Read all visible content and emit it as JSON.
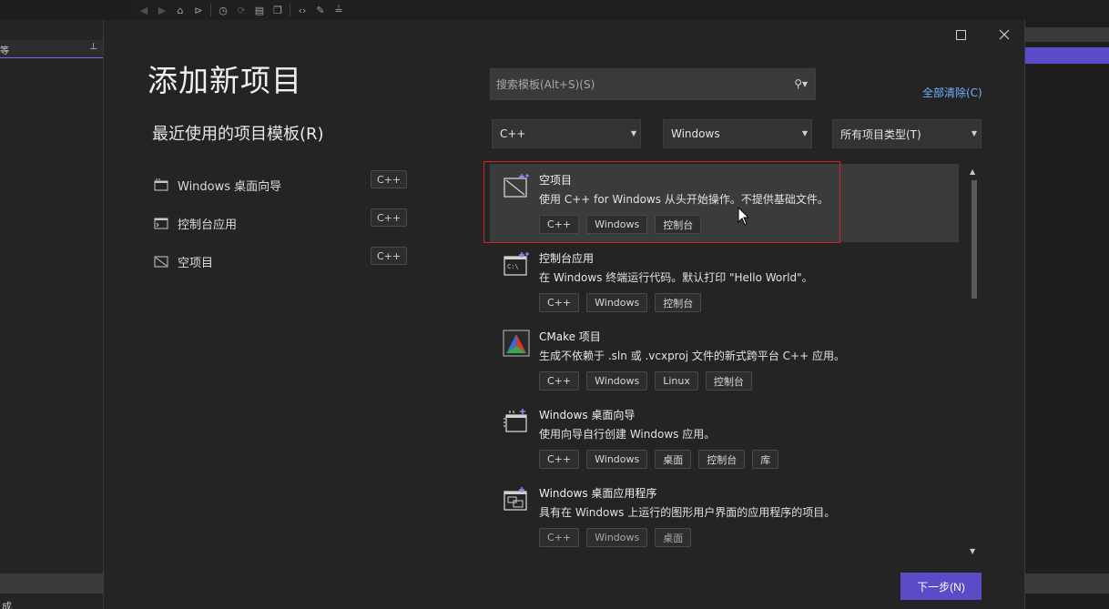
{
  "ide": {
    "left_panel_char": "等",
    "status_char": "成"
  },
  "dialog": {
    "title": "添加新项目",
    "recent_heading": "最近使用的项目模板(R)",
    "recent": [
      {
        "label": "Windows 桌面向导",
        "tag": "C++",
        "icon": "desktop-wizard-icon"
      },
      {
        "label": "控制台应用",
        "tag": "C++",
        "icon": "console-app-icon"
      },
      {
        "label": "空项目",
        "tag": "C++",
        "icon": "empty-project-icon"
      }
    ],
    "search": {
      "placeholder": "搜索模板(Alt+S)(S)"
    },
    "clear_all": "全部清除(C)",
    "filters": {
      "language": "C++",
      "platform": "Windows",
      "project_type": "所有项目类型(T)"
    },
    "templates": [
      {
        "name": "空项目",
        "desc": "使用 C++ for Windows 从头开始操作。不提供基础文件。",
        "tags": [
          "C++",
          "Windows",
          "控制台"
        ],
        "icon": "empty-project-icon"
      },
      {
        "name": "控制台应用",
        "desc": "在 Windows 终端运行代码。默认打印 \"Hello World\"。",
        "tags": [
          "C++",
          "Windows",
          "控制台"
        ],
        "icon": "console-app-icon"
      },
      {
        "name": "CMake 项目",
        "desc": "生成不依赖于 .sln 或 .vcxproj 文件的新式跨平台 C++ 应用。",
        "tags": [
          "C++",
          "Windows",
          "Linux",
          "控制台"
        ],
        "icon": "cmake-icon"
      },
      {
        "name": "Windows 桌面向导",
        "desc": "使用向导自行创建 Windows 应用。",
        "tags": [
          "C++",
          "Windows",
          "桌面",
          "控制台",
          "库"
        ],
        "icon": "desktop-wizard-icon"
      },
      {
        "name": "Windows 桌面应用程序",
        "desc": "具有在 Windows 上运行的图形用户界面的应用程序的项目。",
        "tags": [
          "C++",
          "Windows",
          "桌面"
        ],
        "icon": "desktop-app-icon"
      }
    ],
    "next_button": "下一步(N)"
  },
  "colors": {
    "accent": "#5a4bc7",
    "link": "#6fb0ff",
    "selection_outline": "#d92020"
  }
}
